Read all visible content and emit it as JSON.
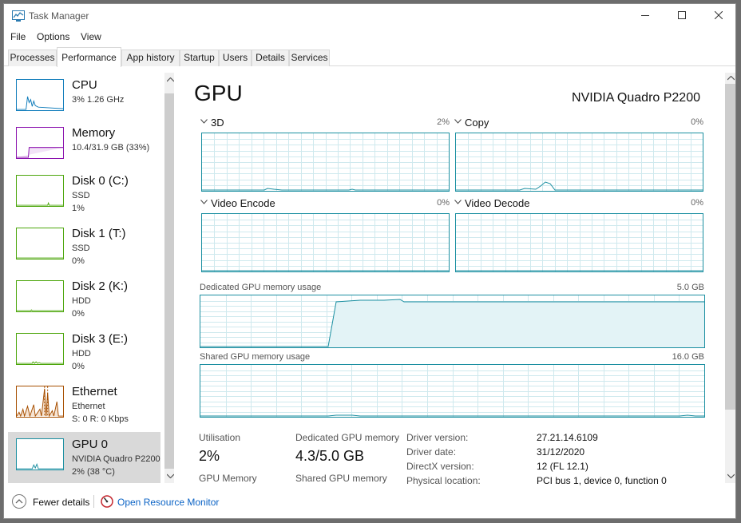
{
  "window": {
    "title": "Task Manager"
  },
  "menu": [
    "File",
    "Options",
    "View"
  ],
  "tabs": [
    "Processes",
    "Performance",
    "App history",
    "Startup",
    "Users",
    "Details",
    "Services"
  ],
  "sidebar": {
    "items": [
      {
        "name": "CPU",
        "line1": "3% 1.26 GHz",
        "line2": "",
        "color": "#117dbb"
      },
      {
        "name": "Memory",
        "line1": "10.4/31.9 GB (33%)",
        "line2": "",
        "color": "#8b12ae"
      },
      {
        "name": "Disk 0 (C:)",
        "line1": "SSD",
        "line2": "1%",
        "color": "#4da60c"
      },
      {
        "name": "Disk 1 (T:)",
        "line1": "SSD",
        "line2": "0%",
        "color": "#4da60c"
      },
      {
        "name": "Disk 2 (K:)",
        "line1": "HDD",
        "line2": "0%",
        "color": "#4da60c"
      },
      {
        "name": "Disk 3 (E:)",
        "line1": "HDD",
        "line2": "0%",
        "color": "#4da60c"
      },
      {
        "name": "Ethernet",
        "line1": "Ethernet",
        "line2": "S: 0 R: 0 Kbps",
        "color": "#a74f01"
      },
      {
        "name": "GPU 0",
        "line1": "NVIDIA Quadro P2200",
        "line2": "2% (38 °C)",
        "color": "#1b8fa1"
      }
    ]
  },
  "main": {
    "title": "GPU",
    "gpu_name": "NVIDIA Quadro P2200",
    "engines": [
      {
        "label": "3D",
        "pct": "2%"
      },
      {
        "label": "Copy",
        "pct": "0%"
      },
      {
        "label": "Video Encode",
        "pct": "0%"
      },
      {
        "label": "Video Decode",
        "pct": "0%"
      }
    ],
    "dedicated": {
      "label": "Dedicated GPU memory usage",
      "max": "5.0 GB"
    },
    "shared": {
      "label": "Shared GPU memory usage",
      "max": "16.0 GB"
    },
    "stats": {
      "utilisation_label": "Utilisation",
      "utilisation_value": "2%",
      "dedicated_label": "Dedicated GPU memory",
      "dedicated_value": "4.3/5.0 GB",
      "gpu_memory_label": "GPU Memory",
      "shared_memory_label": "Shared GPU memory"
    },
    "details": [
      {
        "key": "Driver version:",
        "value": "27.21.14.6109"
      },
      {
        "key": "Driver date:",
        "value": "31/12/2020"
      },
      {
        "key": "DirectX version:",
        "value": "12 (FL 12.1)"
      },
      {
        "key": "Physical location:",
        "value": "PCI bus 1, device 0, function 0"
      }
    ]
  },
  "footer": {
    "fewer_details": "Fewer details",
    "resource_monitor": "Open Resource Monitor"
  }
}
